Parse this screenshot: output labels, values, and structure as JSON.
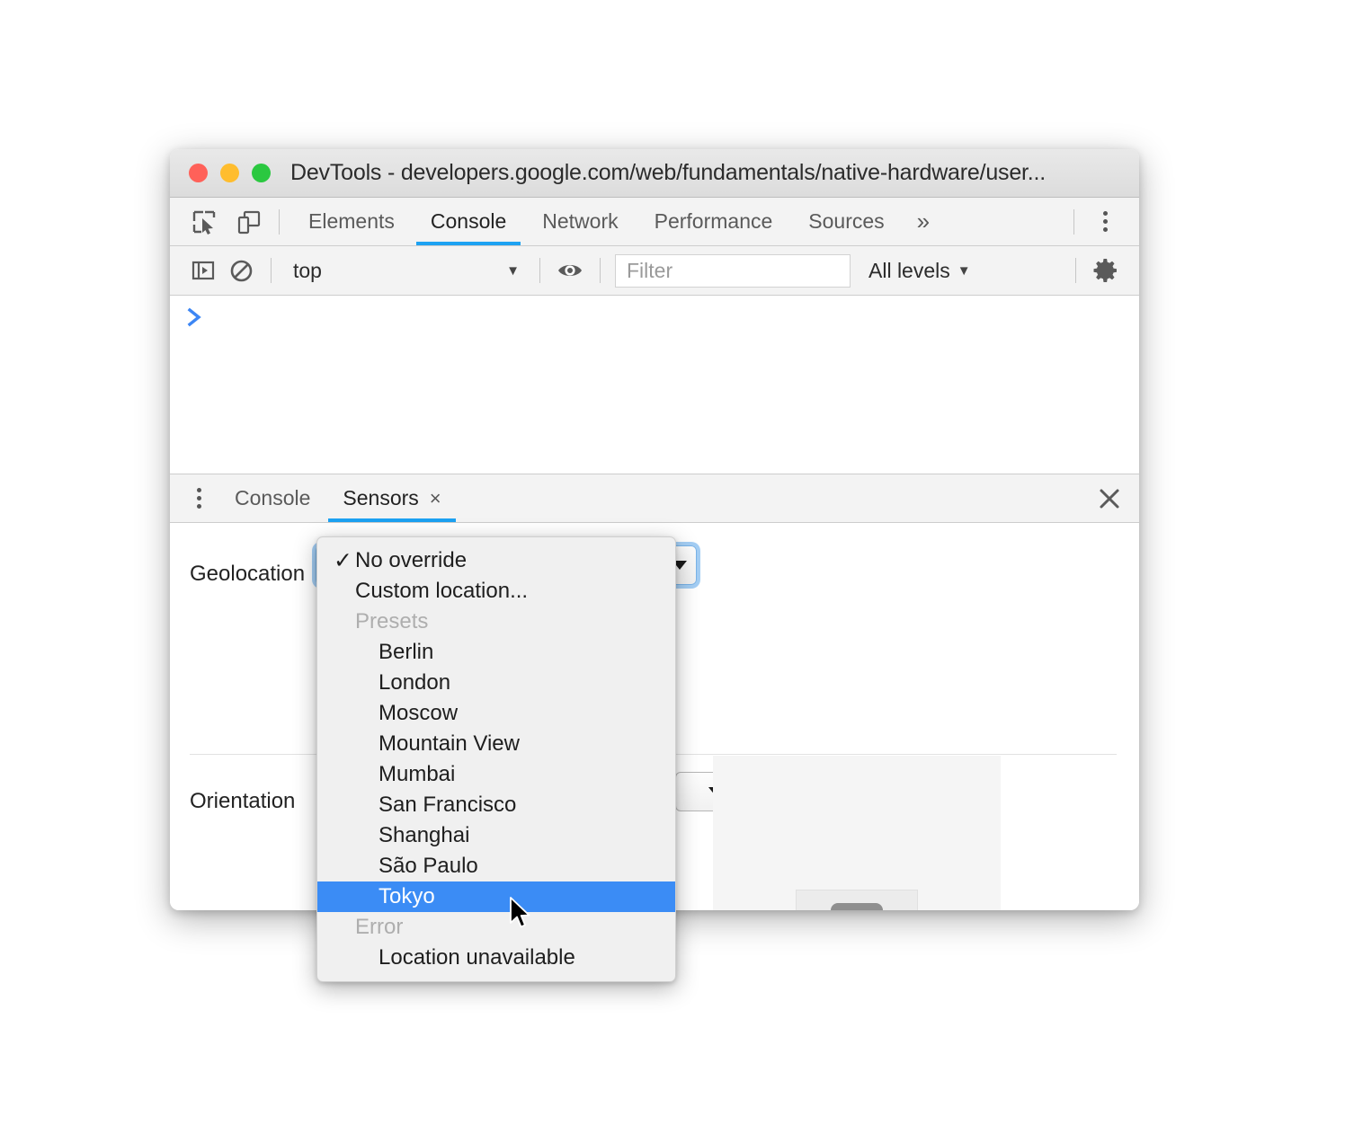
{
  "window": {
    "title": "DevTools - developers.google.com/web/fundamentals/native-hardware/user...",
    "traffic_lights": {
      "close": "close-window",
      "minimize": "minimize-window",
      "maximize": "maximize-window"
    }
  },
  "panel_tabbar": {
    "icons": [
      {
        "name": "inspect-element-icon",
        "title": "Inspect element"
      },
      {
        "name": "device-toolbar-icon",
        "title": "Toggle device toolbar"
      }
    ],
    "tabs": [
      {
        "label": "Elements",
        "active": false
      },
      {
        "label": "Console",
        "active": true
      },
      {
        "label": "Network",
        "active": false
      },
      {
        "label": "Performance",
        "active": false
      },
      {
        "label": "Sources",
        "active": false
      }
    ],
    "more_tabs_label": "»",
    "main_menu": "main-menu-kebab"
  },
  "console_toolbar": {
    "sidebar_toggle": "console-sidebar-icon",
    "clear_console": "clear-console-icon",
    "context": {
      "value": "top",
      "caret": "▼"
    },
    "live_expression": "eye-icon",
    "filter": {
      "value": "",
      "placeholder": "Filter"
    },
    "levels": {
      "value": "All levels",
      "caret": "▼"
    },
    "settings": "settings-gear-icon"
  },
  "console_output": {
    "prompt": "❯",
    "entries": []
  },
  "drawer": {
    "more_tools": "drawer-kebab",
    "tabs": [
      {
        "label": "Console",
        "active": false,
        "closeable": false
      },
      {
        "label": "Sensors",
        "active": true,
        "closeable": true,
        "close_glyph": "×"
      }
    ],
    "close_glyph": "✕"
  },
  "sensors": {
    "geolocation": {
      "label": "Geolocation",
      "selected": "No override",
      "caret": "▼"
    },
    "orientation": {
      "label": "Orientation",
      "selected": "",
      "caret": "▼"
    }
  },
  "dropdown": {
    "items": [
      {
        "label": "No override",
        "checked": true,
        "type": "option",
        "level": "top"
      },
      {
        "label": "Custom location...",
        "checked": false,
        "type": "option",
        "level": "top"
      },
      {
        "label": "Presets",
        "checked": false,
        "type": "group",
        "level": "top"
      },
      {
        "label": "Berlin",
        "checked": false,
        "type": "option",
        "level": "indent"
      },
      {
        "label": "London",
        "checked": false,
        "type": "option",
        "level": "indent"
      },
      {
        "label": "Moscow",
        "checked": false,
        "type": "option",
        "level": "indent"
      },
      {
        "label": "Mountain View",
        "checked": false,
        "type": "option",
        "level": "indent"
      },
      {
        "label": "Mumbai",
        "checked": false,
        "type": "option",
        "level": "indent"
      },
      {
        "label": "San Francisco",
        "checked": false,
        "type": "option",
        "level": "indent"
      },
      {
        "label": "Shanghai",
        "checked": false,
        "type": "option",
        "level": "indent"
      },
      {
        "label": "São Paulo",
        "checked": false,
        "type": "option",
        "level": "indent"
      },
      {
        "label": "Tokyo",
        "checked": false,
        "type": "option",
        "level": "indent",
        "selected": true
      },
      {
        "label": "Error",
        "checked": false,
        "type": "group",
        "level": "top"
      },
      {
        "label": "Location unavailable",
        "checked": false,
        "type": "option",
        "level": "indent"
      }
    ],
    "check_glyph": "✓",
    "highlight_color": "#3b8cf5"
  },
  "colors": {
    "accent_blue": "#1da2f2",
    "menu_highlight": "#3b8cf5",
    "prompt_blue": "#3d86f4",
    "titlebar_bg": "#e3e3e3",
    "toolbar_bg": "#f3f3f3",
    "panel_bg": "#ffffff"
  }
}
